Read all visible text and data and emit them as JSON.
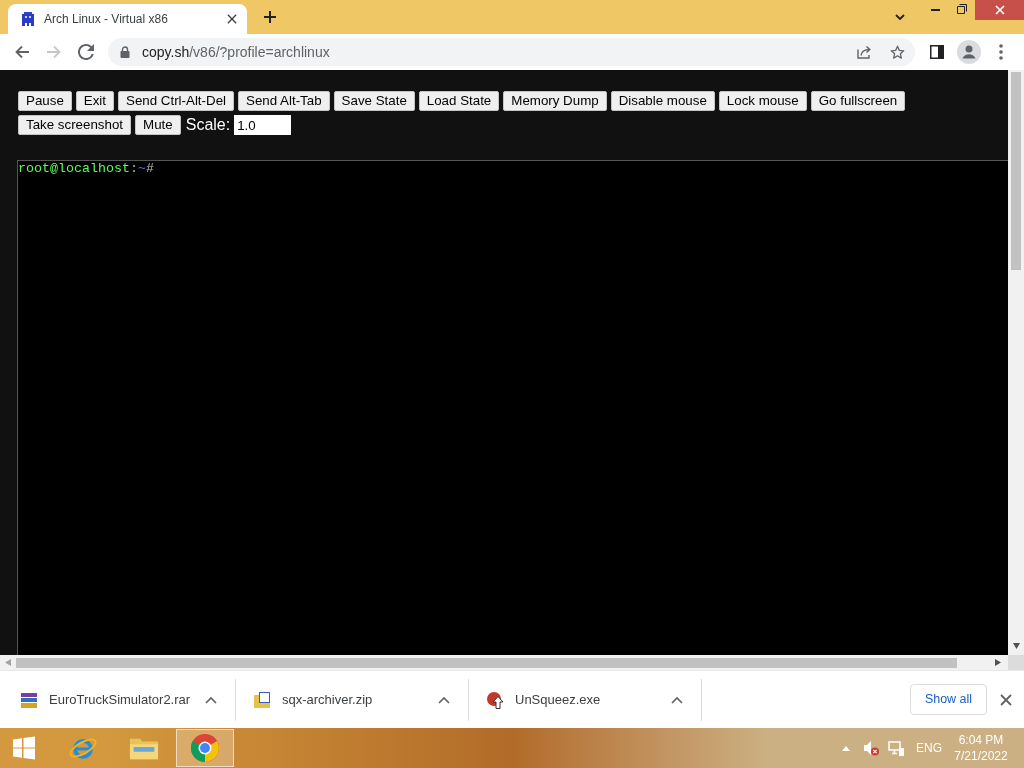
{
  "browser": {
    "tabs": [
      {
        "title": "Arch Linux - Virtual x86",
        "selected": true
      }
    ],
    "nav": [
      {
        "kind": "back",
        "disabled": false
      },
      {
        "kind": "forward",
        "disabled": true
      },
      {
        "kind": "reload",
        "disabled": false
      }
    ],
    "address": {
      "host": "copy.sh",
      "path": "/v86/?profile=archlinux"
    }
  },
  "emulator": {
    "buttons": [
      "Pause",
      "Exit",
      "Send Ctrl-Alt-Del",
      "Send Alt-Tab",
      "Save State",
      "Load State",
      "Memory Dump",
      "Disable mouse",
      "Lock mouse",
      "Go fullscreen",
      "Take screenshot",
      "Mute"
    ],
    "scale": {
      "label": "Scale:",
      "value": "1.0"
    },
    "terminal": {
      "user_host": "root@localhost",
      "separator": ":",
      "cwd": "~",
      "symbol": "#"
    }
  },
  "downloads": {
    "items": [
      {
        "filename": "EuroTruckSimulator2.rar",
        "kind": "rar"
      },
      {
        "filename": "sqx-archiver.zip",
        "kind": "zip"
      },
      {
        "filename": "UnSqueez.exe",
        "kind": "exe"
      }
    ],
    "show_all": "Show all"
  },
  "taskbar": {
    "apps": [
      {
        "kind": "globe",
        "selected": false
      },
      {
        "kind": "folder",
        "selected": false
      },
      {
        "kind": "ring",
        "selected": true
      }
    ],
    "language": "ENG",
    "time": "6:04 PM",
    "date": "7/21/2022"
  }
}
